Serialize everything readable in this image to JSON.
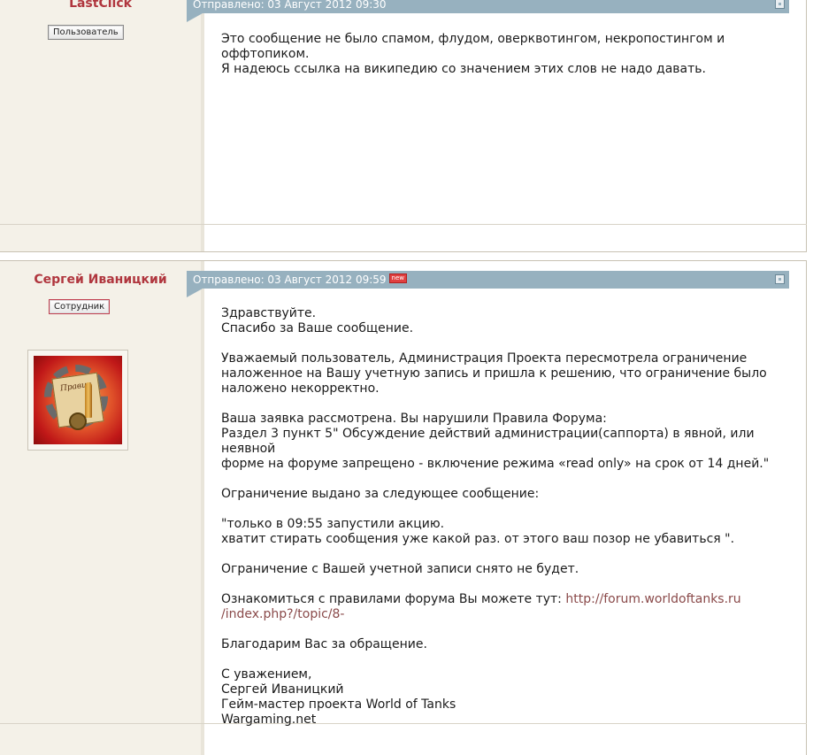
{
  "posts": [
    {
      "author": "LastClick",
      "role": "Пользователь",
      "posted": "Отправлено: 03 Август 2012 09:30",
      "is_new": false,
      "body": "Это сообщение не было спамом, флудом, оверквотингом, некропостингом и\nоффтопиком.\nЯ надеюсь ссылка на википедию со значением этих слов не надо давать."
    },
    {
      "author": "Сергей Иваницкий",
      "role": "Сотрудник",
      "posted": "Отправлено: 03 Август 2012 09:59",
      "is_new": true,
      "new_label": "new",
      "avatar_caption": "Правил",
      "body_before_link": "Здравствуйте.\nСпасибо за Ваше сообщение.\n\nУважаемый пользователь, Администрация Проекта пересмотрела ограничение\nналоженное на Вашу учетную запись и пришла к решению, что ограничение было\nналожено некорректно.\n\nВаша заявка рассмотрена. Вы нарушили Правила Форума:\nРаздел 3 пункт 5\" Обсуждение действий администрации(саппорта) в явной, или неявной\nформе на форуме запрещено - включение режима «read only» на срок от 14 дней.\"\n\nОграничение выдано за следующее сообщение:\n\n\"только в 09:55 запустили акцию.\nхватит стирать сообщения уже какой раз. от этого ваш позор не убавиться \".\n\nОграничение с Вашей учетной записи снято не будет.\n\nОзнакомиться с правилами форума Вы можете тут: ",
      "link": "http://forum.worldoftanks.ru\n/index.php?/topic/8-",
      "body_after_link": "\n\nБлагодарим Вас за обращение.\n\nС уважением,\nСергей Иваницкий\nГейм-мастер проекта World of Tanks\nWargaming.net"
    }
  ],
  "colors": {
    "author": "#b0363e",
    "bar": "#97b1bf",
    "left_column": "#f4f1e8",
    "link": "#8a4a4a"
  }
}
